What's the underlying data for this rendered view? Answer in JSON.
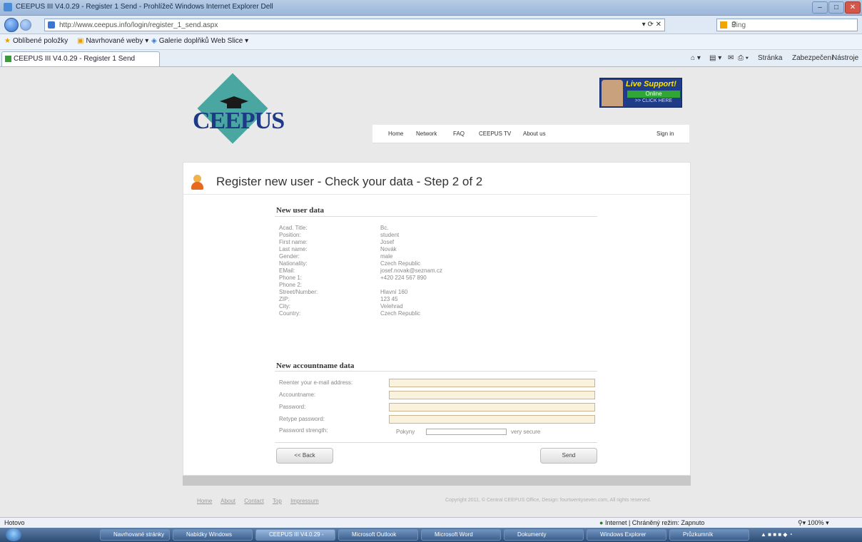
{
  "browser": {
    "window_title": "CEEPUS III V4.0.29 - Register 1 Send - Prohlížeč Windows Internet Explorer Dell",
    "address_url": "http://www.ceepus.info/login/register_1_send.aspx",
    "search_placeholder": "Bing",
    "favorites_label": "Oblíbené položky",
    "fav_item_1": "Navrhované weby",
    "fav_item_2": "Galerie doplňků Web Slice",
    "tab_label": "CEEPUS III V4.0.29 - Register 1 Send",
    "cmd_page": "Stránka",
    "cmd_security": "Zabezpečení",
    "cmd_tools": "Nástroje",
    "status_text": "Hotovo",
    "zone_text": "Internet | Chráněný režim: Zapnuto",
    "zoom_text": "100%",
    "taskbar_items": [
      "Navrhované stránky",
      "Nabídky Windows",
      "CEEPUS III V4.0.29 -",
      "Microsoft Outlook",
      "Microsoft Word",
      "Dokumenty",
      "Windows Explorer",
      "Průzkumník"
    ]
  },
  "site": {
    "brand": "CEEPUS",
    "live_support_title": "Live Support!",
    "live_support_status": "Online",
    "live_support_cta": ">> CLICK HERE",
    "nav": [
      "Home",
      "Network",
      "FAQ",
      "CEEPUS TV",
      "About us"
    ],
    "sign_in": "Sign in"
  },
  "page": {
    "title": "Register new user - Check your data - Step 2 of 2",
    "user_section_title": "New user data",
    "user_fields": [
      {
        "label": "Acad. Title:",
        "value": "Bc."
      },
      {
        "label": "Position:",
        "value": "student"
      },
      {
        "label": "First name:",
        "value": "Josef"
      },
      {
        "label": "Last name:",
        "value": "Novák"
      },
      {
        "label": "Gender:",
        "value": "male"
      },
      {
        "label": "Nationality:",
        "value": "Czech Republic"
      },
      {
        "label": "EMail:",
        "value": "josef.novak@seznam.cz"
      },
      {
        "label": "Phone 1:",
        "value": "+420 224 567 890"
      },
      {
        "label": "Phone 2:",
        "value": ""
      },
      {
        "label": "Street/Number:",
        "value": "Hlavní 160"
      },
      {
        "label": "ZIP:",
        "value": "123 45"
      },
      {
        "label": "City:",
        "value": "Velehrad"
      },
      {
        "label": "Country:",
        "value": "Czech Republic"
      }
    ],
    "account_section_title": "New accountname data",
    "account_fields": [
      {
        "label": "Reenter your e-mail address:",
        "value": ""
      },
      {
        "label": "Accountname:",
        "value": ""
      },
      {
        "label": "Password:",
        "value": ""
      },
      {
        "label": "Retype password:",
        "value": ""
      }
    ],
    "password_strength_label": "Password strength:",
    "password_strength_low": "Pokyny",
    "password_strength_high": "very secure",
    "password_strength_level": 0,
    "back_button": "<< Back",
    "send_button": "Send"
  },
  "footer": {
    "links": [
      "Home",
      "About",
      "Contact",
      "Top",
      "Impressum"
    ],
    "copyright": "Copyright 2011, © Central CEEPUS Office, Design: fourtwentyseven.com, All rights reserved."
  },
  "colors": {
    "input_bg": "#fbf2de",
    "brand_blue": "#1d3a86",
    "logo_teal": "#4aa6a0"
  }
}
